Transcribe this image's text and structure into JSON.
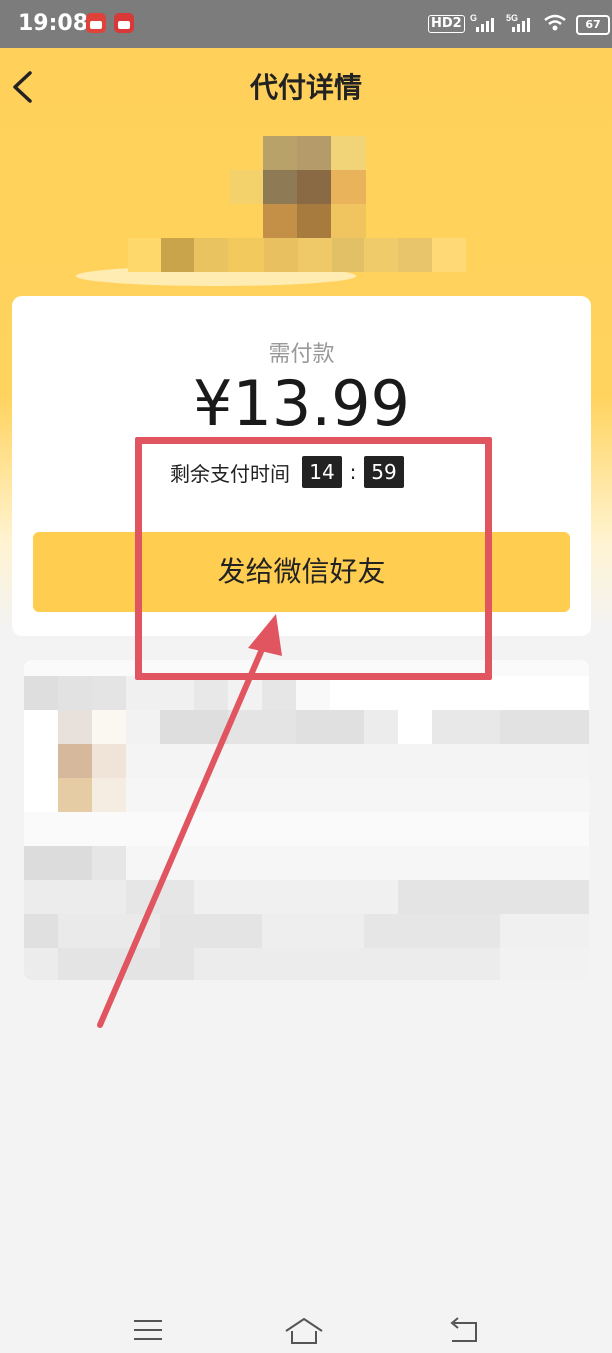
{
  "status_bar": {
    "time": "19:08",
    "network_hd": "HD2",
    "signal_1_label": "G",
    "signal_2_label": "5G",
    "battery": "67",
    "icons": [
      "calendar-app-icon",
      "game-app-icon",
      "signal-icon",
      "wifi-icon",
      "battery-icon"
    ]
  },
  "header": {
    "title": "代付详情",
    "back_icon": "chevron-left-icon",
    "background_color": "#ffd15a"
  },
  "payment": {
    "amount_label": "需付款",
    "amount": "¥13.99",
    "countdown_label": "剩余支付时间",
    "countdown_minutes": "14",
    "countdown_separator": ":",
    "countdown_seconds": "59",
    "share_button_label": "发给微信好友",
    "button_color": "#ffcd4f"
  },
  "annotation": {
    "color": "#e05560"
  },
  "nav_bar": {
    "icons": [
      "menu-icon",
      "home-icon",
      "back-icon"
    ]
  }
}
